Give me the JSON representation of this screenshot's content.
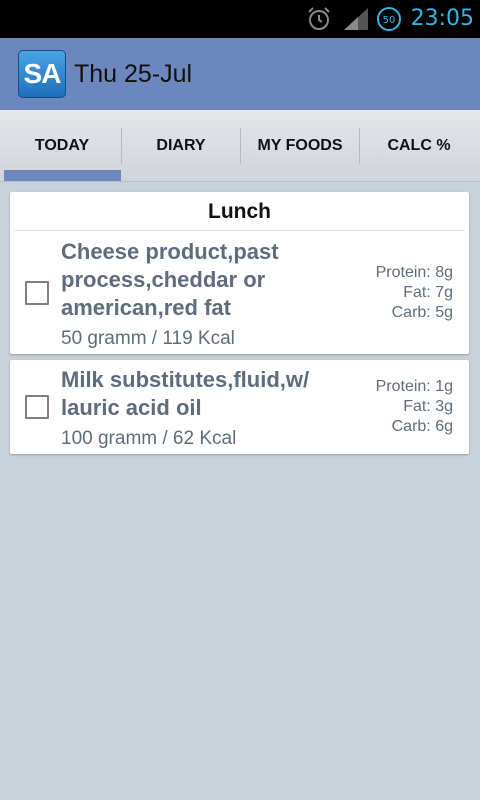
{
  "status_bar": {
    "battery_level": "50",
    "clock": "23:05",
    "accent_color": "#33b5e5"
  },
  "action_bar": {
    "logo_text": "SA",
    "title": "Thu 25-Jul",
    "background_color": "#6b87bd"
  },
  "tabs": [
    {
      "label": "TODAY",
      "selected": true
    },
    {
      "label": "DIARY",
      "selected": false
    },
    {
      "label": "MY FOODS",
      "selected": false
    },
    {
      "label": "CALC %",
      "selected": false
    }
  ],
  "meal": {
    "title": "Lunch",
    "items": [
      {
        "name_lines": [
          "Cheese product,past",
          "process,cheddar or",
          "american,red fat"
        ],
        "amount": "50 gramm / 119 Kcal",
        "protein": "Protein: 8g",
        "fat": "Fat: 7g",
        "carb": "Carb: 5g",
        "checked": false
      },
      {
        "name_lines": [
          "Milk substitutes,fluid,w/",
          "lauric acid oil"
        ],
        "amount": "100 gramm / 62 Kcal",
        "protein": "Protein: 1g",
        "fat": "Fat: 3g",
        "carb": "Carb: 6g",
        "checked": false
      }
    ]
  }
}
